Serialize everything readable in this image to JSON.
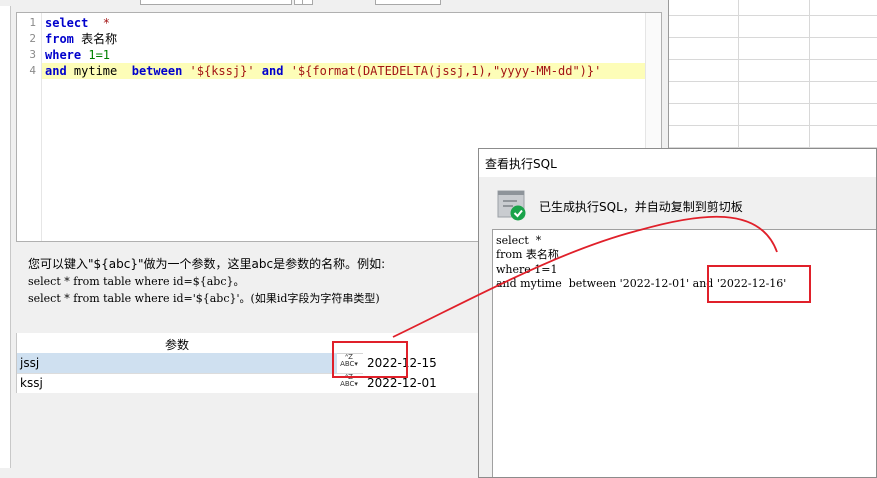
{
  "editor": {
    "line_numbers": [
      "1",
      "2",
      "3",
      "4"
    ],
    "line1": {
      "kw": "select",
      "rest": "  *"
    },
    "line2": {
      "kw": "from",
      "rest": " 表名称"
    },
    "line3": {
      "kw": "where",
      "num": " 1=1"
    },
    "line4": {
      "kw_and": "and",
      "mid": " mytime  ",
      "kw_between": "between",
      "str1": " '${kssj}' ",
      "kw_and2": "and",
      "str2": " '${format(DATEDELTA(jssj,1),\"yyyy-MM-dd\")}'"
    }
  },
  "hint": {
    "line1": "您可以键入\"${abc}\"做为一个参数，这里abc是参数的名称。例如:",
    "line2": "select * from table where id=${abc}。",
    "line3": "select * from table where id='${abc}'。(如果id字段为字符串类型)"
  },
  "params": {
    "header": "参数",
    "rows": [
      {
        "name": "jssj",
        "value": "2022-12-15"
      },
      {
        "name": "kssj",
        "value": "2022-12-01"
      }
    ]
  },
  "dialog": {
    "title": "查看执行SQL",
    "message": "已生成执行SQL，并自动复制到剪切板",
    "sql_lines": [
      "select  *",
      "from 表名称",
      "where 1=1",
      "and mytime  between '2022-12-01' and '2022-12-16'"
    ]
  },
  "colors": {
    "annotation_red": "#e0202a",
    "keyword_blue": "#0000cc",
    "string_red": "#a31515",
    "highlight_line": "#fdfdb8",
    "selected_row": "#cfe0f0",
    "success_green": "#1aa34a"
  }
}
